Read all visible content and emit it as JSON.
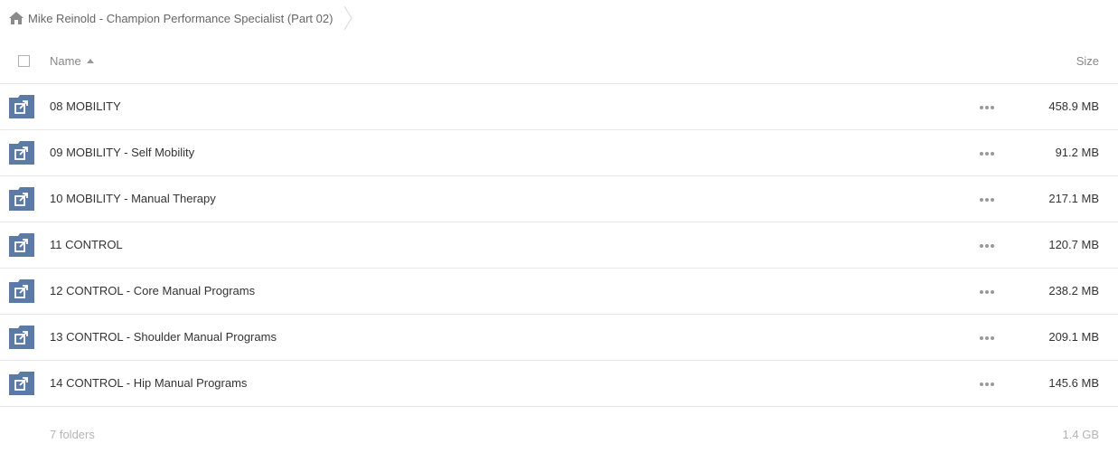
{
  "breadcrumb": {
    "icon": "home-icon",
    "title": "Mike Reinold - Champion Performance Specialist (Part 02)"
  },
  "header": {
    "name_label": "Name",
    "size_label": "Size",
    "sort_icon": "sort-ascending-icon"
  },
  "rows": [
    {
      "name": "08 MOBILITY",
      "size": "458.9 MB"
    },
    {
      "name": "09 MOBILITY - Self Mobility",
      "size": "91.2 MB"
    },
    {
      "name": "10 MOBILITY - Manual Therapy",
      "size": "217.1 MB"
    },
    {
      "name": "11 CONTROL",
      "size": "120.7 MB"
    },
    {
      "name": "12 CONTROL - Core Manual Programs",
      "size": "238.2 MB"
    },
    {
      "name": "13 CONTROL - Shoulder Manual Programs",
      "size": "209.1 MB"
    },
    {
      "name": "14 CONTROL - Hip Manual Programs",
      "size": "145.6 MB"
    }
  ],
  "footer": {
    "count": "7 folders",
    "total": "1.4 GB"
  },
  "colors": {
    "folder": "#5b7aa6",
    "border": "#e6e6e6",
    "muted": "#b5b5b5"
  }
}
